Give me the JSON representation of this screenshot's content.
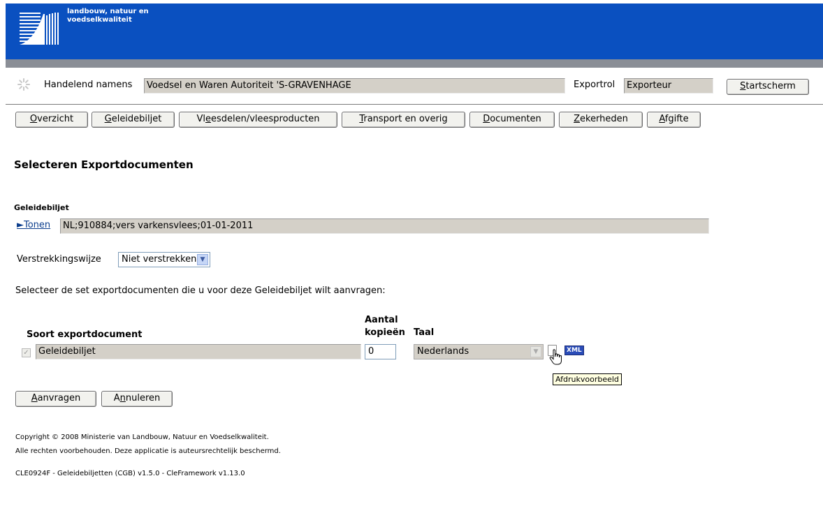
{
  "header": {
    "logo_text": "landbouw, natuur en\nvoedselkwaliteit"
  },
  "context_bar": {
    "handelend_label": "Handelend namens",
    "handelend_value": "Voedsel en Waren Autoriteit 'S-GRAVENHAGE",
    "exportrol_label": "Exportrol",
    "exportrol_value": "Exporteur",
    "startscherm_button": {
      "prefix": "",
      "mnemonic": "S",
      "rest": "tartscherm"
    }
  },
  "nav": [
    {
      "mnemonic": "O",
      "rest": "verzicht",
      "prefix": ""
    },
    {
      "mnemonic": "G",
      "rest": "eleidebiljet",
      "prefix": ""
    },
    {
      "prefix": "Vl",
      "mnemonic": "e",
      "rest": "esdelen/vleesproducten"
    },
    {
      "mnemonic": "T",
      "rest": "ransport en overig",
      "prefix": ""
    },
    {
      "mnemonic": "D",
      "rest": "ocumenten",
      "prefix": ""
    },
    {
      "mnemonic": "Z",
      "rest": "ekerheden",
      "prefix": ""
    },
    {
      "mnemonic": "A",
      "rest": "fgifte",
      "prefix": ""
    }
  ],
  "page": {
    "title": "Selecteren Exportdocumenten",
    "section_label": "Geleidebiljet",
    "tonen_link": "►Tonen",
    "geleidebiljet_value": "NL;910884;vers varkensvlees;01-01-2011",
    "verstrekkingswijze_label": "Verstrekkingswijze",
    "verstrekkingswijze_value": "Niet verstrekken",
    "instruction": "Selecteer de set exportdocumenten die u voor deze Geleidebiljet wilt aanvragen:"
  },
  "doc_table": {
    "col_soort": "Soort exportdocument",
    "col_aantal_line1": "Aantal",
    "col_aantal_line2": "kopieën",
    "col_taal": "Taal",
    "rows": [
      {
        "soort": "Geleidebiljet",
        "aantal": "0",
        "taal": "Nederlands",
        "checked": true
      }
    ],
    "xml_label": "XML",
    "tooltip": "Afdrukvoorbeeld"
  },
  "actions": {
    "aanvragen": {
      "prefix": "",
      "mnemonic": "A",
      "rest": "anvragen"
    },
    "annuleren": {
      "prefix": "A",
      "mnemonic": "n",
      "rest": "nuleren"
    }
  },
  "footer": {
    "copyright": "Copyright © 2008 Ministerie van Landbouw, Natuur en Voedselkwaliteit.",
    "rights": "Alle rechten voorbehouden. Deze applicatie is auteursrechtelijk beschermd.",
    "version": "CLE0924F - Geleidebiljetten (CGB) v1.5.0 - CleFramework v1.13.0"
  },
  "colors": {
    "header_blue": "#0a50c0",
    "header_strip": "#8a8e96",
    "readonly_field": "#d4d0c8",
    "link": "#0a3c8c"
  }
}
